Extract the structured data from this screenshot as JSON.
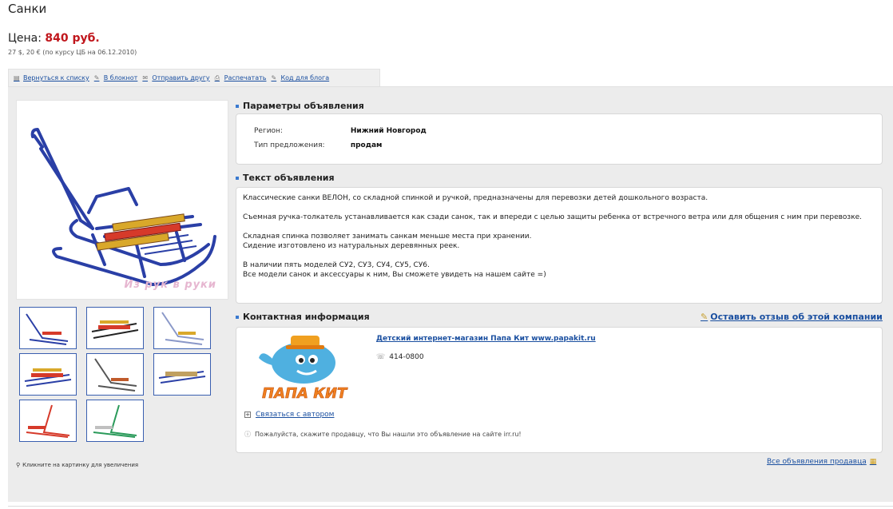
{
  "page": {
    "title": "Санки",
    "price_label": "Цена:",
    "price_value": "840 руб.",
    "price_sub": "27 $, 20 € (по курсу ЦБ на 06.12.2010)"
  },
  "actions": [
    {
      "label": "Вернуться к списку",
      "icon": "list-icon"
    },
    {
      "label": "В блокнот",
      "icon": "notepad-icon"
    },
    {
      "label": "Отправить другу",
      "icon": "mail-icon"
    },
    {
      "label": "Распечатать",
      "icon": "print-icon"
    },
    {
      "label": "Код для блога",
      "icon": "blog-icon"
    }
  ],
  "params": {
    "heading": "Параметры объявления",
    "rows": [
      {
        "key": "Регион:",
        "value": "Нижний Новгород"
      },
      {
        "key": "Тип предложения:",
        "value": "продам"
      }
    ]
  },
  "ad_text": {
    "heading": "Текст объявления",
    "p1": "Классические санки ВЕЛОН, со складной спинкой и ручкой, предназначены для перевозки детей дошкольного возраста.",
    "p2": "Съемная ручка-толкатель устанавливается как сзади санок, так и впереди с целью защиты ребенка от встречного ветра или для общения с ним при перевозке.",
    "p3a": "Складная спинка позволяет занимать санкам меньше места при хранении.",
    "p3b": "Сидение изготовлено из натуральных деревянных реек.",
    "p4a": "В наличии пять моделей СУ2, СУ3, СУ4, СУ5, СУ6.",
    "p4b": "Все модели санок и аксессуары к ним, Вы сможете увидеть на нашем сайте =)"
  },
  "contact": {
    "heading": "Контактная информация",
    "review_link": "Оставить отзыв об этой компании",
    "shop_name": "Детский интернет-магазин Папа Кит www.papakit.ru",
    "phone": "414-0800",
    "contact_author": "Связаться с автором",
    "please_note": "Пожалуйста, скажите продавцу, что Вы нашли это объявление на сайте irr.ru!",
    "logo_text": "ПАПА КИТ"
  },
  "gallery": {
    "zoom_hint": "Кликните на картинку для увеличения",
    "watermark": "Из рук в руки"
  },
  "footer": {
    "all_ads": "Все объявления продавца"
  },
  "colors": {
    "price": "#c0161c",
    "link": "#1a4fa0",
    "sled_frame": "#2a3fa6"
  }
}
